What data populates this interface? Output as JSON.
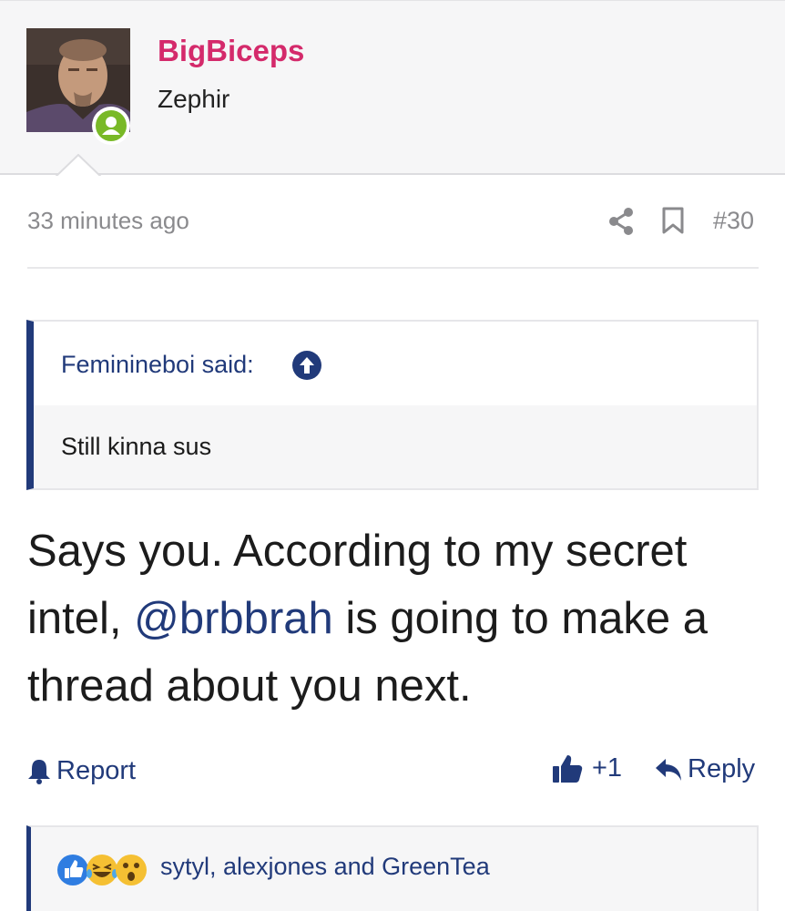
{
  "user": {
    "name": "BigBiceps",
    "title": "Zephir",
    "online": true
  },
  "post": {
    "time": "33 minutes ago",
    "number": "#30"
  },
  "quote": {
    "author_label": "Feminineboi said:",
    "text": "Still kinna sus"
  },
  "message": {
    "part1": "Says you. According to my secret intel, ",
    "mention": "@brbbrah",
    "part2": " is going to make a thread about you next."
  },
  "actions": {
    "report_label": "Report",
    "like_count": "+1",
    "reply_label": "Reply"
  },
  "reactions": {
    "names": "sytyl, alexjones and GreenTea",
    "icons": [
      "like-icon",
      "laughing-crying-icon",
      "wow-icon"
    ]
  },
  "colors": {
    "username": "#d42a6b",
    "link": "#213a7a",
    "online": "#79b927"
  }
}
